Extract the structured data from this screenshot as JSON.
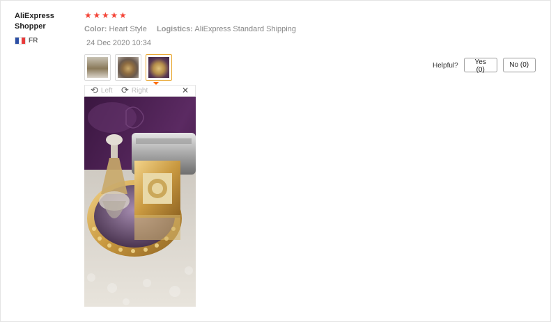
{
  "reviewer": {
    "name": "AliExpress Shopper",
    "country_code": "FR",
    "flag_colors": [
      "#2c4fa5",
      "#ffffff",
      "#e83b3b"
    ]
  },
  "review": {
    "rating": 5,
    "star_glyph": "★",
    "star_color": "#f44336",
    "color_label": "Color:",
    "color_value": "Heart Style",
    "logistics_label": "Logistics:",
    "logistics_value": "AliExpress Standard Shipping",
    "date": "24 Dec 2020 10:34"
  },
  "thumbnails": [
    {
      "name": "thumbnail-1",
      "active": false
    },
    {
      "name": "thumbnail-2",
      "active": false
    },
    {
      "name": "thumbnail-3",
      "active": true
    }
  ],
  "viewer": {
    "rotate_left_label": "Left",
    "rotate_right_label": "Right",
    "rotate_left_icon": "rotate-left-icon",
    "rotate_right_icon": "rotate-right-icon",
    "close_icon": "close-icon",
    "close_glyph": "✕"
  },
  "helpful": {
    "label": "Helpful?",
    "yes_label": "Yes (0)",
    "no_label": "No (0)"
  },
  "colors": {
    "active_thumb_border": "#e8a52e",
    "caret": "#ff6a00"
  }
}
